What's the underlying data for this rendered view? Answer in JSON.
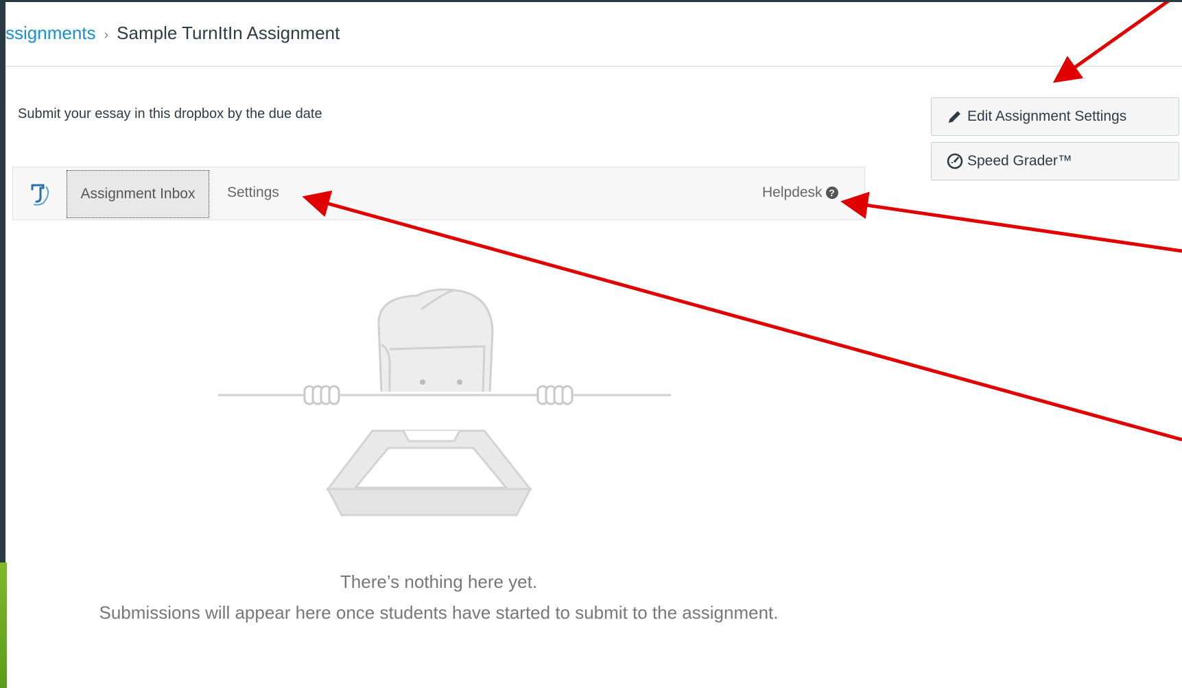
{
  "breadcrumb": {
    "parent": "ssignments",
    "separator": "›",
    "current": "Sample TurnItIn Assignment"
  },
  "description": "Submit your essay in this dropbox by the due date",
  "actions": {
    "edit_settings": "Edit Assignment Settings",
    "speed_grader": "Speed Grader™"
  },
  "turnitin": {
    "tabs": [
      "Assignment Inbox",
      "Settings"
    ],
    "helpdesk": "Helpdesk",
    "helpdesk_icon": "question-circle-icon"
  },
  "empty_state": {
    "title": "There’s nothing here yet.",
    "subtitle": "Submissions will appear here once students have started to submit to the assignment."
  },
  "colors": {
    "link": "#1a8fd0",
    "annotation_arrow": "#e00000",
    "outer_background": "#2a3a42"
  }
}
